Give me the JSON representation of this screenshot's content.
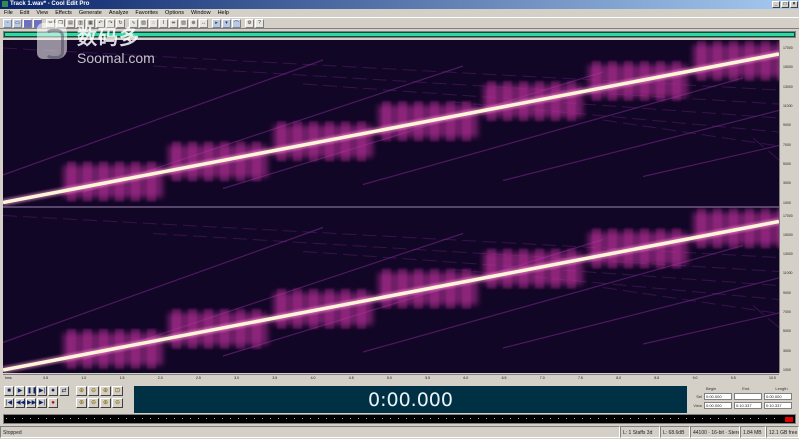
{
  "window": {
    "title": "Track 1.wav* - Cool Edit Pro",
    "controls": [
      "_",
      "□",
      "×"
    ]
  },
  "menu": [
    "File",
    "Edit",
    "View",
    "Effects",
    "Generate",
    "Analyze",
    "Favorites",
    "Options",
    "Window",
    "Help"
  ],
  "toolbar_icons": [
    "new-file-icon",
    "open-icon",
    "save-icon",
    "multitrack-icon",
    "cut-icon",
    "copy-icon",
    "paste-icon",
    "paste-new-icon",
    "mix-paste-icon",
    "undo-icon",
    "redo-icon",
    "repeat-icon",
    "waveform-view-icon",
    "spectral-view-icon",
    "loop-icon",
    "cursor-icon",
    "select-time-icon",
    "select-spectral-icon",
    "zoom-tool-icon",
    "scrub-icon",
    "play-head-icon",
    "markers-icon",
    "envelope-icon",
    "settings-icon",
    "help-icon"
  ],
  "watermark": {
    "chinese": "数码多",
    "english": "Soomal.com"
  },
  "spectrogram": {
    "channels": 2,
    "colors": {
      "background": "#120626",
      "band": "#c0309e",
      "sweep": "#fff6d8",
      "alias": "#7a2a8e"
    }
  },
  "frequency_ruler": {
    "ticks": [
      "17000",
      "16000",
      "15000",
      "14000",
      "13000",
      "12000",
      "11000",
      "10000",
      "9000",
      "8000",
      "7000",
      "6000",
      "5000",
      "4000",
      "3000",
      "2000",
      "1000"
    ]
  },
  "timeline_ruler": {
    "labels": [
      "hms",
      "0.5",
      "1.0",
      "1.5",
      "2.0",
      "2.5",
      "3.0",
      "3.5",
      "4.0",
      "4.5",
      "5.0",
      "5.5",
      "6.0",
      "6.5",
      "7.0",
      "7.5",
      "8.0",
      "8.5",
      "9.0",
      "9.5",
      "10.0"
    ]
  },
  "transport": {
    "row1": [
      "■",
      "▶",
      "❚❚",
      "▶|",
      "⏺",
      "⇄"
    ],
    "row2": [
      "|◀",
      "◀◀",
      "▶▶",
      "▶|",
      "●"
    ]
  },
  "zoom_controls": {
    "row1": [
      "⊕",
      "⊖",
      "⊕",
      "⊡"
    ],
    "row2": [
      "⊕",
      "⊖",
      "⊕",
      "⊖"
    ]
  },
  "time_display": "0:00.000",
  "selection": {
    "headers": [
      "Begin",
      "End",
      "Length"
    ],
    "rows": [
      {
        "label": "Sel",
        "values": [
          "0:00.000",
          "",
          "0:00.000"
        ]
      },
      {
        "label": "View",
        "values": [
          "0:00.000",
          "0:10.337",
          "0:10.337"
        ]
      }
    ]
  },
  "status": {
    "state": "Stopped",
    "fields": [
      "L: 1 Staffs 3d",
      "L: 68.6dB",
      "44100 · 16-bit · Stereo",
      "1.84 MB",
      "12.1 GB free"
    ]
  }
}
